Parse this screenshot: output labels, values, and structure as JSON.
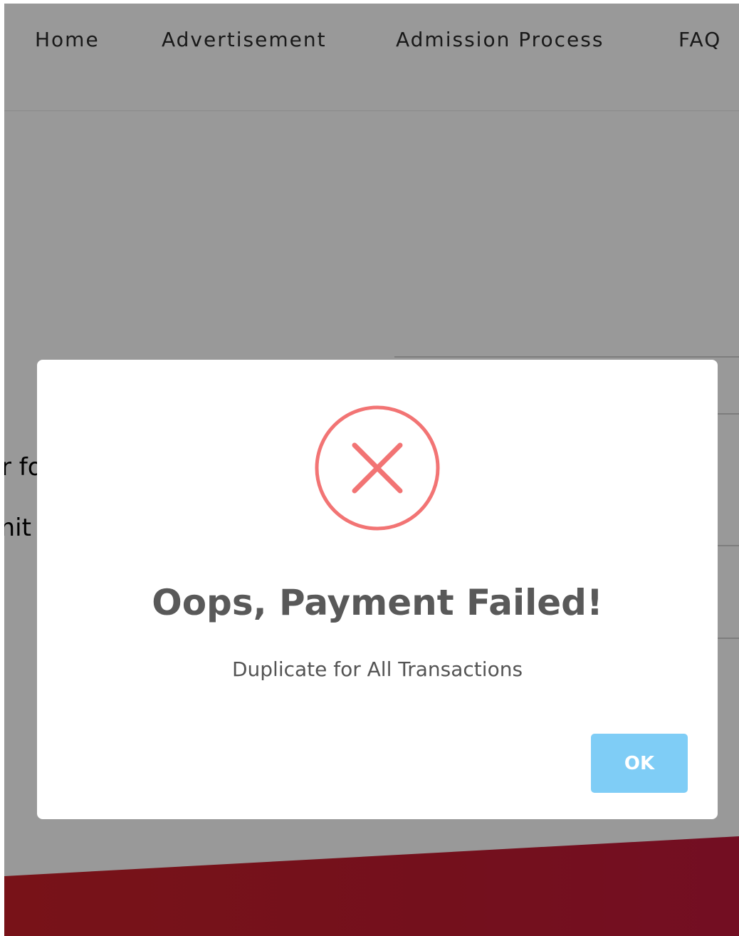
{
  "nav": {
    "items": [
      {
        "label": "Home"
      },
      {
        "label": "Advertisement"
      },
      {
        "label": "Admission Process"
      },
      {
        "label": "FAQ"
      }
    ]
  },
  "background": {
    "fragment_1": "r fo",
    "fragment_2": "mit"
  },
  "modal": {
    "icon": "error-x-icon",
    "title": "Oops, Payment Failed!",
    "text": "Duplicate for All Transactions",
    "ok_label": "OK"
  },
  "colors": {
    "error_icon": "#f27474",
    "ok_button": "#7fcdf6",
    "footer_band": "#c21c30",
    "overlay": "rgba(0,0,0,0.4)"
  }
}
